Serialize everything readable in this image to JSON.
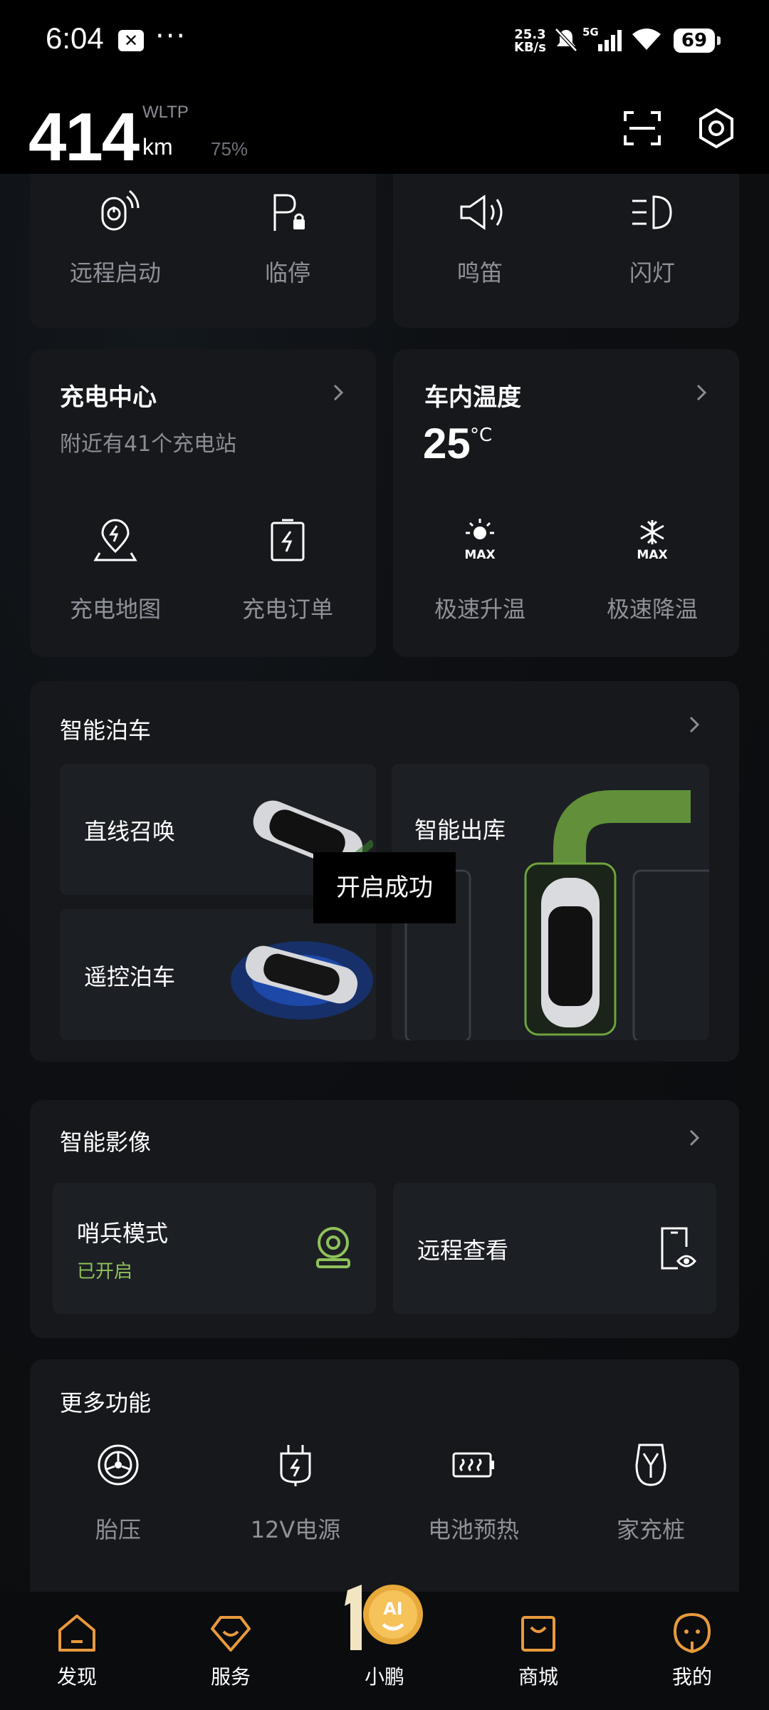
{
  "status_bar": {
    "time": "6:04",
    "net_speed_value": "25.3",
    "net_speed_unit": "KB/s",
    "network": "5G",
    "battery": "69"
  },
  "header": {
    "range": "414",
    "standard": "WLTP",
    "unit": "km",
    "battery_pct": "75%"
  },
  "quick_controls": {
    "remote_start": "远程启动",
    "temp_park": "临停",
    "horn": "鸣笛",
    "flash": "闪灯"
  },
  "charging": {
    "title": "充电中心",
    "subtitle": "附近有41个充电站",
    "map_label": "充电地图",
    "orders_label": "充电订单"
  },
  "cabin_temp": {
    "title": "车内温度",
    "value": "25",
    "unit": "°C",
    "heat_label": "极速升温",
    "cool_label": "极速降温",
    "max_text": "MAX"
  },
  "parking": {
    "title": "智能泊车",
    "summon_label": "直线召唤",
    "remote_park_label": "遥控泊车",
    "exit_label": "智能出库"
  },
  "toast": "开启成功",
  "smart_imaging": {
    "title": "智能影像",
    "sentry_label": "哨兵模式",
    "sentry_status": "已开启",
    "remote_view_label": "远程查看"
  },
  "more": {
    "title": "更多功能",
    "tire_label": "胎压",
    "power_label": "12V电源",
    "battery_label": "电池预热",
    "charger_label": "家充桩"
  },
  "nav": {
    "discover": "发现",
    "service": "服务",
    "xpeng": "小鹏",
    "mall": "商城",
    "mine": "我的",
    "logo_text": "AI"
  },
  "colors": {
    "accent_green": "#8fc15a",
    "card_bg": "#16181c",
    "muted_text": "#8e9198"
  }
}
